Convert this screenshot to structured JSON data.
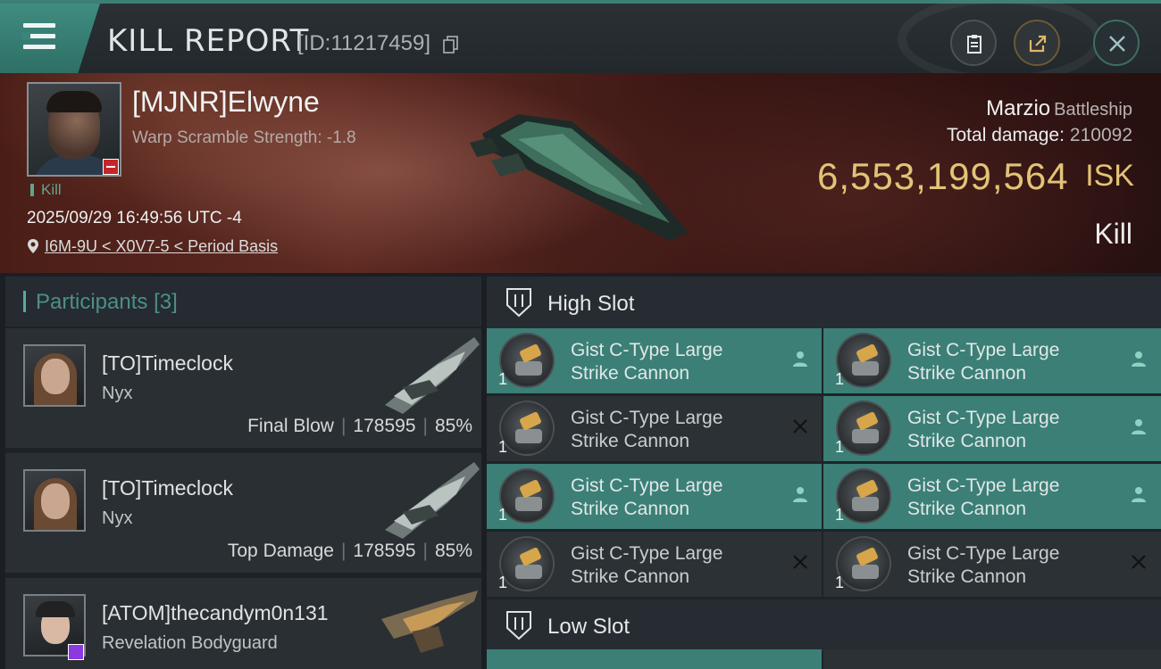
{
  "header": {
    "title": "KILL REPORT",
    "report_id": "[ID:11217459]",
    "menu_icon": "hamburger-menu-icon",
    "buttons": [
      "clipboard-icon",
      "share-icon",
      "close-icon"
    ]
  },
  "victim": {
    "name": "[MJNR]Elwyne",
    "warp_scramble": "Warp Scramble Strength: -1.8",
    "tag": "Kill",
    "datetime": "2025/09/29 16:49:56 UTC -4",
    "location": "I6M-9U < X0V7-5 < Period Basis",
    "ship_name": "Marzio",
    "ship_class": "Battleship",
    "total_damage_label": "Total damage:",
    "total_damage_value": "210092",
    "isk_value": "6,553,199,564",
    "isk_unit": "ISK",
    "result": "Kill"
  },
  "participants": {
    "label": "Participants",
    "count": "[3]",
    "rows": [
      {
        "name": "[TO]Timeclock",
        "ship": "Nyx",
        "role": "Final Blow",
        "damage": "178595",
        "percent": "85%"
      },
      {
        "name": "[TO]Timeclock",
        "ship": "Nyx",
        "role": "Top Damage",
        "damage": "178595",
        "percent": "85%"
      },
      {
        "name": "[ATOM]thecandym0n131",
        "ship": "Revelation Bodyguard",
        "role": "",
        "damage": "",
        "percent": ""
      }
    ]
  },
  "fitting": {
    "high_slot_label": "High Slot",
    "low_slot_label": "Low Slot",
    "modules": [
      {
        "name_line1": "Gist C-Type Large",
        "name_line2": "Strike Cannon",
        "qty": "1",
        "state": "dropped"
      },
      {
        "name_line1": "Gist C-Type Large",
        "name_line2": "Strike Cannon",
        "qty": "1",
        "state": "dropped"
      },
      {
        "name_line1": "Gist C-Type Large",
        "name_line2": "Strike Cannon",
        "qty": "1",
        "state": "destroyed"
      },
      {
        "name_line1": "Gist C-Type Large",
        "name_line2": "Strike Cannon",
        "qty": "1",
        "state": "dropped"
      },
      {
        "name_line1": "Gist C-Type Large",
        "name_line2": "Strike Cannon",
        "qty": "1",
        "state": "dropped"
      },
      {
        "name_line1": "Gist C-Type Large",
        "name_line2": "Strike Cannon",
        "qty": "1",
        "state": "dropped"
      },
      {
        "name_line1": "Gist C-Type Large",
        "name_line2": "Strike Cannon",
        "qty": "1",
        "state": "destroyed"
      },
      {
        "name_line1": "Gist C-Type Large",
        "name_line2": "Strike Cannon",
        "qty": "1",
        "state": "destroyed"
      }
    ]
  },
  "colors": {
    "accent_teal": "#3b7f76",
    "isk_gold": "#e3c376",
    "destroyed_bg": "#2c3135"
  }
}
